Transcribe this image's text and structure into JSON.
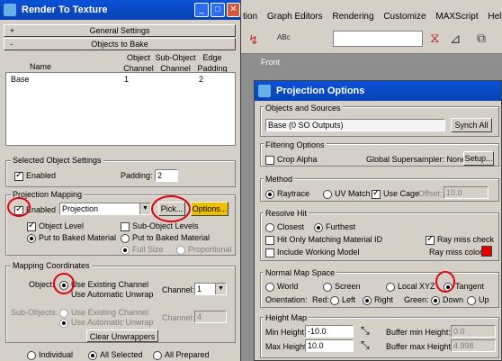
{
  "rtt": {
    "title": "Render To Texture",
    "roll_general": "General Settings",
    "roll_objects": "Objects to Bake",
    "col_name": "Name",
    "col_obj_channel": "Object Channel",
    "col_subobj_channel": "Sub-Object Channel",
    "col_edge_padding": "Edge Padding",
    "row_name": "Base",
    "row_channel": "1",
    "row_padding": "2",
    "sel_settings_title": "Selected Object Settings",
    "enabled": "Enabled",
    "padding_label": "Padding:",
    "padding_value": "2",
    "proj_mapping_title": "Projection Mapping",
    "proj_enabled": "Enabled",
    "proj_modifier": "Projection",
    "pick": "Pick...",
    "options": "Options...",
    "object_level": "Object Level",
    "subobject_levels": "Sub-Object Levels",
    "put_baked": "Put to Baked Material",
    "put_baked2": "Put to Baked Material",
    "full_size": "Full Size",
    "proportional": "Proportional",
    "mapping_title": "Mapping Coordinates",
    "object_label": "Object:",
    "use_existing": "Use Existing Channel",
    "use_auto": "Use Automatic Unwrap",
    "channel_label": "Channel:",
    "channel_value": "1",
    "subobjects_label": "Sub-Objects:",
    "sub_use_existing": "Use Existing Channel",
    "sub_use_auto": "Use Automatic Unwrap",
    "sub_channel_label": "Channel:",
    "sub_channel_value": "4",
    "clear_unwrappers": "Clear Unwrappers",
    "individual": "Individual",
    "all_selected": "All Selected",
    "all_prepared": "All Prepared"
  },
  "menubar": {
    "items": [
      "tion",
      "Graph Editors",
      "Rendering",
      "Customize",
      "MAXScript",
      "Help"
    ]
  },
  "viewport": {
    "label": "Front"
  },
  "proj": {
    "title": "Projection Options",
    "objects_sources": "Objects and Sources",
    "source_value": "Base (0 SO Outputs)",
    "synch_all": "Synch All",
    "filtering": "Filtering Options",
    "crop_alpha": "Crop Alpha",
    "global_ss": "Global Supersampler: None",
    "setup": "Setup...",
    "method": "Method",
    "raytrace": "Raytrace",
    "uv_match": "UV Match",
    "use_cage": "Use Cage",
    "offset_label": "Offset:",
    "offset_value": "10.0",
    "resolve_hit": "Resolve Hit",
    "closest": "Closest",
    "furthest": "Furthest",
    "hit_only": "Hit Only Matching Material ID",
    "ray_miss_check": "Ray miss check",
    "include_working": "Include Working Model",
    "ray_miss_color": "Ray miss color:",
    "normal_map_space": "Normal Map Space",
    "world": "World",
    "screen": "Screen",
    "local_xyz": "Local XYZ",
    "tangent": "Tangent",
    "orientation": "Orientation:",
    "red": "Red:",
    "left": "Left",
    "right": "Right",
    "green": "Green:",
    "down": "Down",
    "up": "Up",
    "height_map": "Height Map",
    "min_height": "Min Height:",
    "min_value": "-10.0",
    "max_height": "Max Height:",
    "max_value": "10.0",
    "buf_min": "Buffer min Height:",
    "buf_min_value": "0.0",
    "buf_max": "Buffer max Height:",
    "buf_max_value": "4.998"
  },
  "colors": {
    "ray_miss": "#e00000",
    "annotation": "#e00010"
  }
}
